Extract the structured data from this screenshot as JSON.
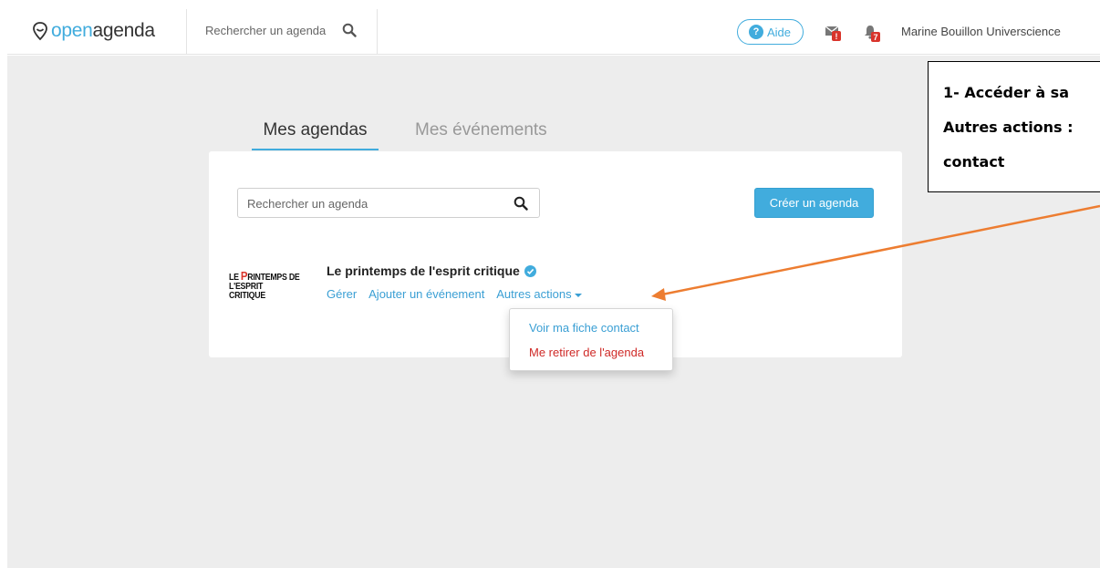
{
  "header": {
    "logo_open": "open",
    "logo_agenda": "agenda",
    "search_placeholder": "Rechercher un agenda",
    "help_label": "Aide",
    "messages_badge": "!",
    "notifications_badge": "7",
    "user_name": "Marine Bouillon Universcience"
  },
  "tabs": [
    {
      "label": "Mes agendas",
      "active": true
    },
    {
      "label": "Mes événements",
      "active": false
    }
  ],
  "panel": {
    "search_placeholder": "Rechercher un agenda",
    "create_button": "Créer un agenda"
  },
  "agenda": {
    "logo_line1_prefix": "LE ",
    "logo_line1_p": "P",
    "logo_line1_rest": "RINTEMPS DE",
    "logo_line2": "L'ESPRIT CRITIQUE",
    "title": "Le printemps de l'esprit critique",
    "actions": [
      "Gérer",
      "Ajouter un événement",
      "Autres actions"
    ]
  },
  "dropdown": {
    "items": [
      "Voir ma fiche contact",
      "Me retirer de l'agenda"
    ]
  },
  "callout": {
    "lines": [
      "1- Accéder à sa",
      "Autres actions :",
      "contact"
    ]
  },
  "colors": {
    "accent": "#41acdd",
    "danger": "#cf2a27",
    "arrow": "#ed7d31",
    "background": "#ededed"
  }
}
